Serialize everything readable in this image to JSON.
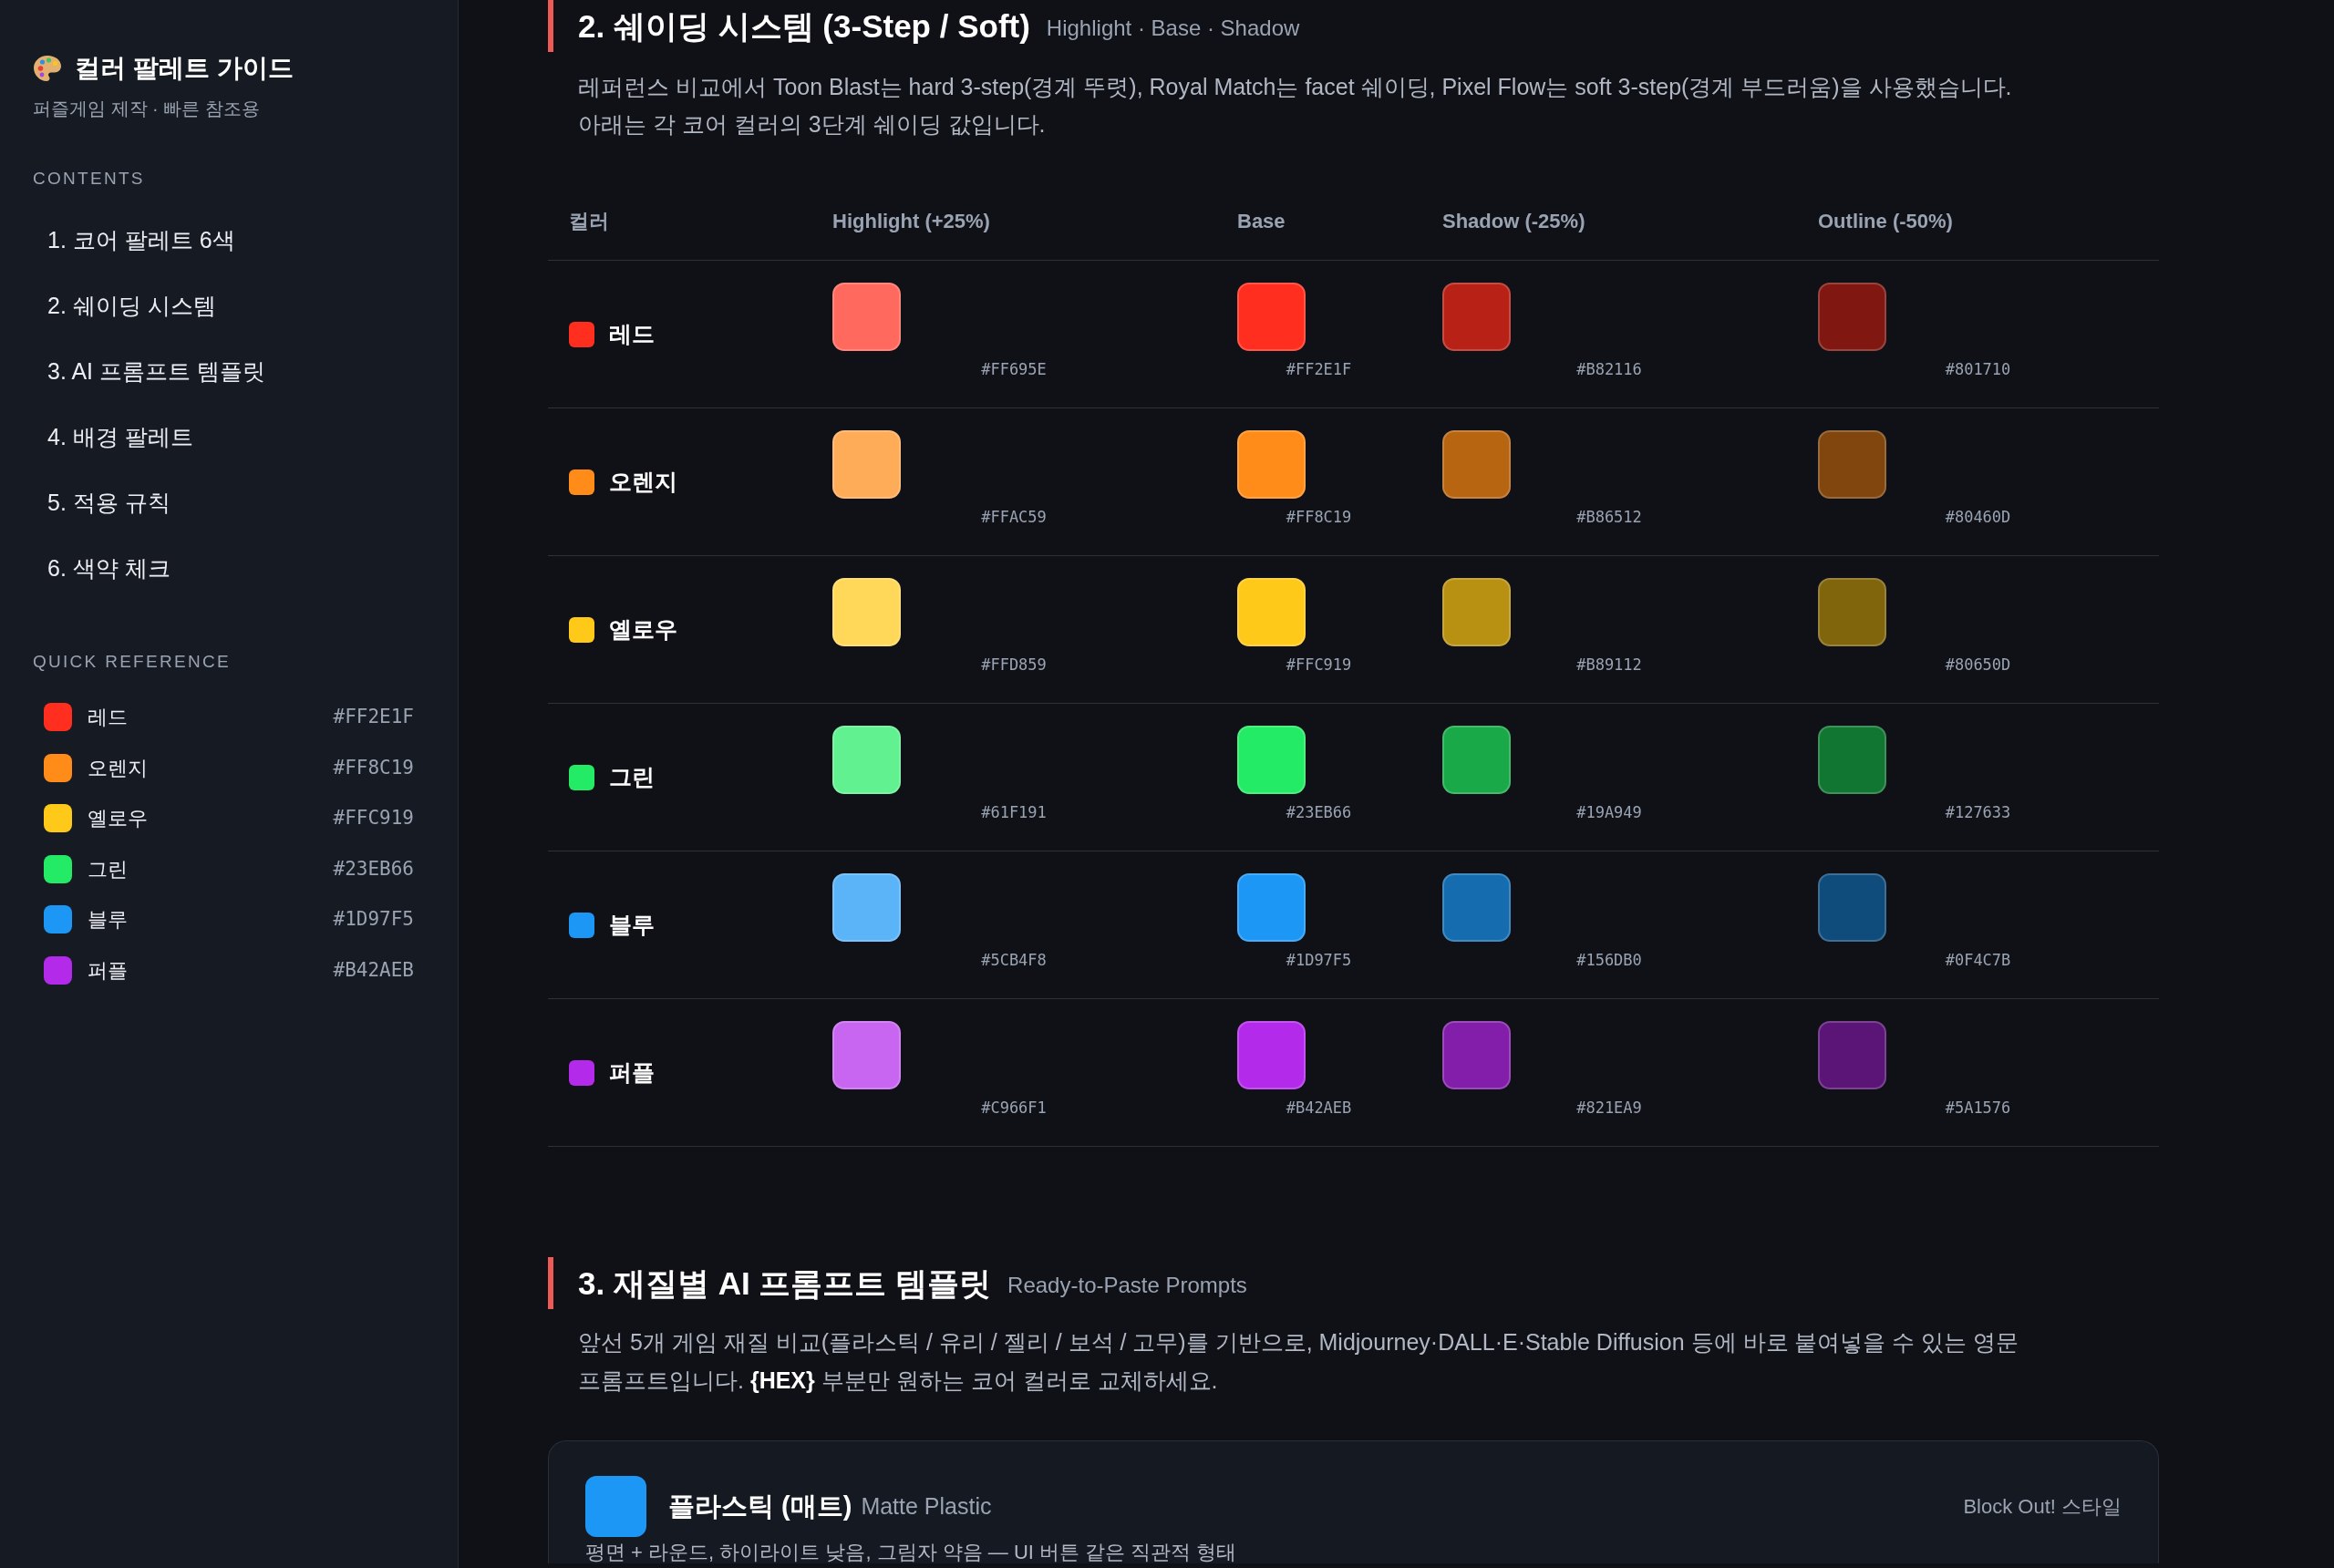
{
  "sidebar": {
    "title": "컬러 팔레트 가이드",
    "subtitle": "퍼즐게임 제작 · 빠른 참조용",
    "contents_heading": "CONTENTS",
    "contents": [
      {
        "label": "1. 코어 팔레트 6색"
      },
      {
        "label": "2. 쉐이딩 시스템"
      },
      {
        "label": "3. AI 프롬프트 템플릿"
      },
      {
        "label": "4. 배경 팔레트"
      },
      {
        "label": "5. 적용 규칙"
      },
      {
        "label": "6. 색약 체크"
      }
    ],
    "quick_reference_heading": "QUICK REFERENCE",
    "quick_reference": [
      {
        "name": "레드",
        "hex": "#FF2E1F",
        "color": "#ff2e1f"
      },
      {
        "name": "오렌지",
        "hex": "#FF8C19",
        "color": "#ff8c19"
      },
      {
        "name": "옐로우",
        "hex": "#FFC919",
        "color": "#ffc919"
      },
      {
        "name": "그린",
        "hex": "#23EB66",
        "color": "#23eb66"
      },
      {
        "name": "블루",
        "hex": "#1D97F5",
        "color": "#1d97f5"
      },
      {
        "name": "퍼플",
        "hex": "#B42AEB",
        "color": "#b42aeb"
      }
    ]
  },
  "shading_section": {
    "title": "2. 쉐이딩 시스템 (3-Step / Soft)",
    "subtitle": "Highlight · Base · Shadow",
    "description": "레퍼런스 비교에서 Toon Blast는 hard 3-step(경계 뚜렷), Royal Match는 facet 쉐이딩, Pixel Flow는 soft 3-step(경계 부드러움)을 사용했습니다. 아래는 각 코어 컬러의 3단계 쉐이딩 값입니다.",
    "table": {
      "columns": [
        "컬러",
        "Highlight (+25%)",
        "Base",
        "Shadow (-25%)",
        "Outline (-50%)"
      ],
      "rows": [
        {
          "name": "레드",
          "color": "#ff2e1f",
          "swatches": [
            {
              "hex": "#FF695E",
              "color": "#ff695e"
            },
            {
              "hex": "#FF2E1F",
              "color": "#ff2e1f"
            },
            {
              "hex": "#B82116",
              "color": "#b82116"
            },
            {
              "hex": "#801710",
              "color": "#801710"
            }
          ]
        },
        {
          "name": "오렌지",
          "color": "#ff8c19",
          "swatches": [
            {
              "hex": "#FFAC59",
              "color": "#ffac59"
            },
            {
              "hex": "#FF8C19",
              "color": "#ff8c19"
            },
            {
              "hex": "#B86512",
              "color": "#b86512"
            },
            {
              "hex": "#80460D",
              "color": "#80460d"
            }
          ]
        },
        {
          "name": "옐로우",
          "color": "#ffc919",
          "swatches": [
            {
              "hex": "#FFD859",
              "color": "#ffd859"
            },
            {
              "hex": "#FFC919",
              "color": "#ffc919"
            },
            {
              "hex": "#B89112",
              "color": "#b89112"
            },
            {
              "hex": "#80650D",
              "color": "#80650d"
            }
          ]
        },
        {
          "name": "그린",
          "color": "#23eb66",
          "swatches": [
            {
              "hex": "#61F191",
              "color": "#61f191"
            },
            {
              "hex": "#23EB66",
              "color": "#23eb66"
            },
            {
              "hex": "#19A949",
              "color": "#19a949"
            },
            {
              "hex": "#127633",
              "color": "#127633"
            }
          ]
        },
        {
          "name": "블루",
          "color": "#1d97f5",
          "swatches": [
            {
              "hex": "#5CB4F8",
              "color": "#5cb4f8"
            },
            {
              "hex": "#1D97F5",
              "color": "#1d97f5"
            },
            {
              "hex": "#156DB0",
              "color": "#156db0"
            },
            {
              "hex": "#0F4C7B",
              "color": "#0f4c7b"
            }
          ]
        },
        {
          "name": "퍼플",
          "color": "#b42aeb",
          "swatches": [
            {
              "hex": "#C966F1",
              "color": "#c966f1"
            },
            {
              "hex": "#B42AEB",
              "color": "#b42aeb"
            },
            {
              "hex": "#821EA9",
              "color": "#821ea9"
            },
            {
              "hex": "#5A1576",
              "color": "#5a1576"
            }
          ]
        }
      ]
    }
  },
  "prompt_section": {
    "title": "3. 재질별 AI 프롬프트 템플릿",
    "subtitle": "Ready-to-Paste Prompts",
    "description": "앞선 5개 게임 재질 비교(플라스틱 / 유리 / 젤리 / 보석 / 고무)를 기반으로, Midjourney·DALL·E·Stable Diffusion 등에 바로 붙여넣을 수 있는 영문 프롬프트입니다. **{HEX}** 부분만 원하는 코어 컬러로 교체하세요.",
    "cards": [
      {
        "title": "플라스틱 (매트)",
        "subtitle": "Matte Plastic",
        "tag": "Block Out! 스타일",
        "color": "#1d97f5",
        "description": "평면 + 라운드, 하이라이트 낮음, 그림자 약음 — UI 버튼 같은 직관적 형태"
      }
    ]
  }
}
